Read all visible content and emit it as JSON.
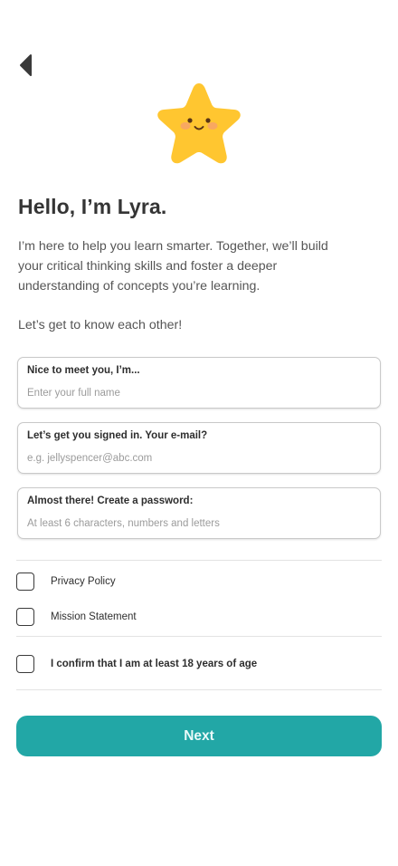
{
  "header": {
    "back_icon": "back-arrow-icon"
  },
  "mascot": {
    "icon": "star-mascot-icon",
    "body_color": "#FFC630",
    "cheek_color": "#F7A26A"
  },
  "intro": {
    "title": "Hello, I’m Lyra.",
    "description": "I’m here to help you learn smarter. Together, we’ll build your critical thinking skills and foster a deeper understanding of concepts you’re learning.",
    "prompt": "Let’s get to know each other!"
  },
  "form": {
    "name": {
      "label": "Nice to meet you, I’m...",
      "placeholder": "Enter your full name",
      "value": ""
    },
    "email": {
      "label": "Let’s get you signed in. Your e-mail?",
      "placeholder": "e.g. jellyspencer@abc.com",
      "value": ""
    },
    "password": {
      "label": "Almost there! Create a password:",
      "placeholder": "At least 6 characters, numbers and letters",
      "value": ""
    }
  },
  "consents": {
    "privacy_policy": {
      "label": "Privacy Policy",
      "checked": false
    },
    "mission_statement": {
      "label": "Mission Statement",
      "checked": false
    },
    "age_confirm": {
      "label": "I confirm that I am at least 18 years of age",
      "checked": false
    }
  },
  "actions": {
    "next_label": "Next",
    "accent_color": "#22A7A6"
  }
}
